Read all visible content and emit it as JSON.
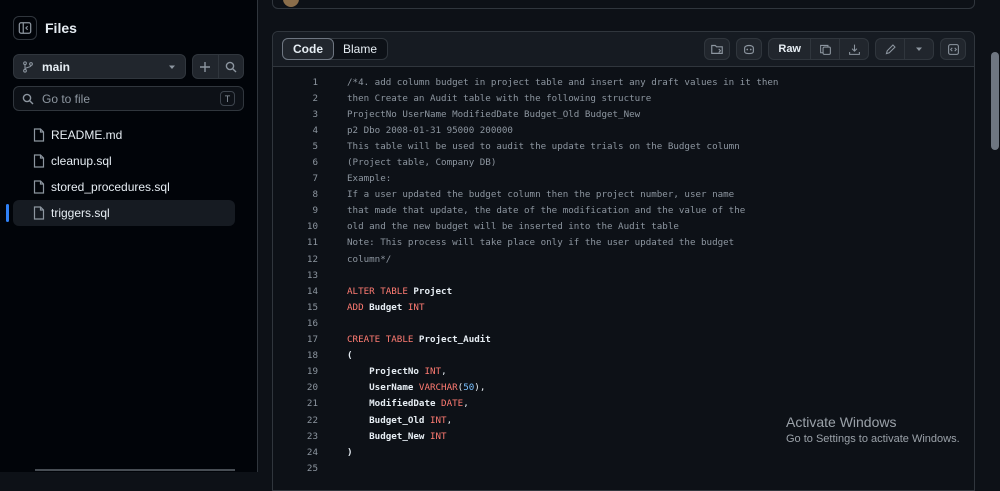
{
  "sidebar": {
    "title": "Files",
    "branch": "main",
    "search_placeholder": "Go to file",
    "search_shortcut": "T",
    "files": [
      {
        "name": "README.md",
        "active": false
      },
      {
        "name": "cleanup.sql",
        "active": false
      },
      {
        "name": "stored_procedures.sql",
        "active": false
      },
      {
        "name": "triggers.sql",
        "active": true
      }
    ]
  },
  "toolbar": {
    "tabs": [
      "Code",
      "Blame"
    ],
    "active_tab": "Code",
    "raw_label": "Raw"
  },
  "code": {
    "lines": [
      {
        "n": "1",
        "t": [
          {
            "c": "cc",
            "s": "/*4. add column budget in project table and insert any draft values in it then"
          }
        ]
      },
      {
        "n": "2",
        "t": [
          {
            "c": "cc",
            "s": "then Create an Audit table with the following structure"
          }
        ]
      },
      {
        "n": "3",
        "t": [
          {
            "c": "cc",
            "s": "ProjectNo UserName ModifiedDate Budget_Old Budget_New"
          }
        ]
      },
      {
        "n": "4",
        "t": [
          {
            "c": "cc",
            "s": "p2 Dbo 2008-01-31 95000 200000"
          }
        ]
      },
      {
        "n": "5",
        "t": [
          {
            "c": "cc",
            "s": "This table will be used to audit the update trials on the Budget column"
          }
        ]
      },
      {
        "n": "6",
        "t": [
          {
            "c": "cc",
            "s": "(Project table, Company DB)"
          }
        ]
      },
      {
        "n": "7",
        "t": [
          {
            "c": "cc",
            "s": "Example:"
          }
        ]
      },
      {
        "n": "8",
        "t": [
          {
            "c": "cc",
            "s": "If a user updated the budget column then the project number, user name"
          }
        ]
      },
      {
        "n": "9",
        "t": [
          {
            "c": "cc",
            "s": "that made that update, the date of the modification and the value of the"
          }
        ]
      },
      {
        "n": "10",
        "t": [
          {
            "c": "cc",
            "s": "old and the new budget will be inserted into the Audit table"
          }
        ]
      },
      {
        "n": "11",
        "t": [
          {
            "c": "cc",
            "s": "Note: This process will take place only if the user updated the budget"
          }
        ]
      },
      {
        "n": "12",
        "t": [
          {
            "c": "cc",
            "s": "column*/"
          }
        ]
      },
      {
        "n": "13",
        "t": []
      },
      {
        "n": "14",
        "t": [
          {
            "c": "kw",
            "s": "ALTER TABLE "
          },
          {
            "c": "id",
            "s": "Project"
          }
        ]
      },
      {
        "n": "15",
        "t": [
          {
            "c": "kw",
            "s": "ADD "
          },
          {
            "c": "id",
            "s": "Budget "
          },
          {
            "c": "kw",
            "s": "INT"
          }
        ]
      },
      {
        "n": "16",
        "t": []
      },
      {
        "n": "17",
        "t": [
          {
            "c": "kw",
            "s": "CREATE TABLE "
          },
          {
            "c": "id",
            "s": "Project_Audit"
          }
        ]
      },
      {
        "n": "18",
        "t": [
          {
            "c": "id",
            "s": "("
          }
        ]
      },
      {
        "n": "19",
        "t": [
          {
            "c": "id",
            "s": "    ProjectNo "
          },
          {
            "c": "kw",
            "s": "INT"
          },
          {
            "c": "code",
            "s": ","
          }
        ]
      },
      {
        "n": "20",
        "t": [
          {
            "c": "id",
            "s": "    UserName "
          },
          {
            "c": "kw",
            "s": "VARCHAR"
          },
          {
            "c": "code",
            "s": "("
          },
          {
            "c": "num",
            "s": "50"
          },
          {
            "c": "code",
            "s": "),"
          }
        ]
      },
      {
        "n": "21",
        "t": [
          {
            "c": "id",
            "s": "    ModifiedDate "
          },
          {
            "c": "kw",
            "s": "DATE"
          },
          {
            "c": "code",
            "s": ","
          }
        ]
      },
      {
        "n": "22",
        "t": [
          {
            "c": "id",
            "s": "    Budget_Old "
          },
          {
            "c": "kw",
            "s": "INT"
          },
          {
            "c": "code",
            "s": ","
          }
        ]
      },
      {
        "n": "23",
        "t": [
          {
            "c": "id",
            "s": "    Budget_New "
          },
          {
            "c": "kw",
            "s": "INT"
          }
        ]
      },
      {
        "n": "24",
        "t": [
          {
            "c": "id",
            "s": ")"
          }
        ]
      },
      {
        "n": "25",
        "t": []
      }
    ]
  },
  "watermark": {
    "title": "Activate Windows",
    "subtitle": "Go to Settings to activate Windows."
  },
  "colors": {
    "background": "#0d1117",
    "sidebar_bg": "#010409",
    "border": "#30363d",
    "accent": "#2f81f7",
    "keyword": "#ff7b72",
    "number": "#79c0ff",
    "comment": "#8d96a0"
  },
  "icons": {
    "sidebar_toggle": "sidebar-collapse-icon",
    "branch": "git-branch-icon",
    "file": "file-icon",
    "search": "search-icon",
    "plus": "plus-icon"
  }
}
